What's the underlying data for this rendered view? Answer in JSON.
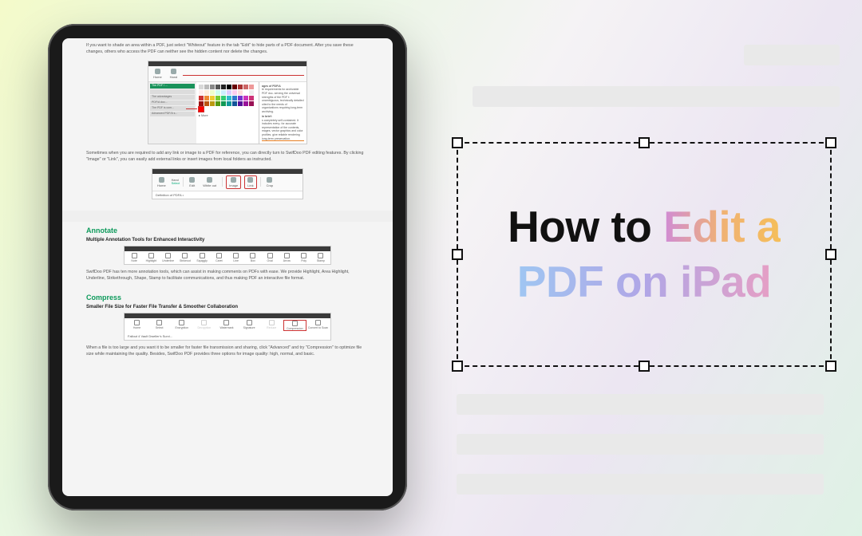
{
  "title": {
    "part1": "How to ",
    "part2": "Edit a",
    "part3": "PDF on iPad"
  },
  "ipad": {
    "para_whiteout": "If you want to shade an area within a PDF, just select \"Whiteout\" feature in the tab \"Edit\" to hide parts of a PDF document. After you save these changes, others who access the PDF can neither see the hidden content nor delete the changes.",
    "para_imglink": "Sometimes when you are required to add any link or image to a PDF for reference, you can directly turn to SwifDoo PDF editing features. By clicking \"Image\" or \"Link\", you can easily add external links or insert images from local folders as instructed.",
    "annotate_heading": "Annotate",
    "annotate_sub": "Multiple Annotation Tools for Enhanced Interactivity",
    "annotate_para": "SwifDoo PDF has ten more annotation tools, which can assist in making comments on PDFs with ease. We provide Highlight, Area Highlight, Underline, Strikethrough, Shape, Stamp to facilitate communications, and thus making PDF an interactive file format.",
    "compress_heading": "Compress",
    "compress_sub": "Smaller File Size for Faster File Transfer & Smoother Collaboration",
    "compress_para": "When a file is too large and you want it to be smaller for faster file transmission and sharing, click \"Advanced\" and try \"Compression\" to optimize file size while maintaining the quality. Besides, SwifDoo PDF provides three options for image quality: high, normal, and basic.",
    "palette_title": "ages of PDF/A",
    "palette_text1": "te requirements for archivable PDF doc-\nserving the universal strengths of the PDF\nt: unambiguous, technically detailed\nuited to the needs of organizations requiring\nlong-term archiving.",
    "palette_sub": "in brief:",
    "palette_text2": "s completely self-contained. It includes every-\nfor accurate representation of the contents,\nmages, vector graphics and color profiles.\ngive reliable rendering\nlong-term preservation.",
    "toolbar_small": {
      "items": [
        "Home",
        "Select",
        "Edit",
        "White out",
        "Image",
        "Link",
        "Crop"
      ],
      "hand": "Hand",
      "caption": "Definition of PDFA •"
    },
    "anno_tools": [
      "Note",
      "Highlight",
      "Underline",
      "Strikeout",
      "Squiggly",
      "Caret",
      "Line",
      "Box",
      "Oval",
      "Arrow",
      "Poly",
      "Stamp"
    ],
    "compress_tools": [
      "Home",
      "Select",
      "Encryption",
      "Decryption",
      "Watermark",
      "Signature",
      "Reduce",
      "Compression",
      "Convert to Scan"
    ],
    "compress_caption": "Fallout 4 Vault Dweller's Survi...",
    "side_items": [
      "The PDF / ...",
      "",
      "The advantages",
      "PDF/A doc...",
      "The PDF is com...",
      "Advanced PDF/A s..."
    ]
  }
}
